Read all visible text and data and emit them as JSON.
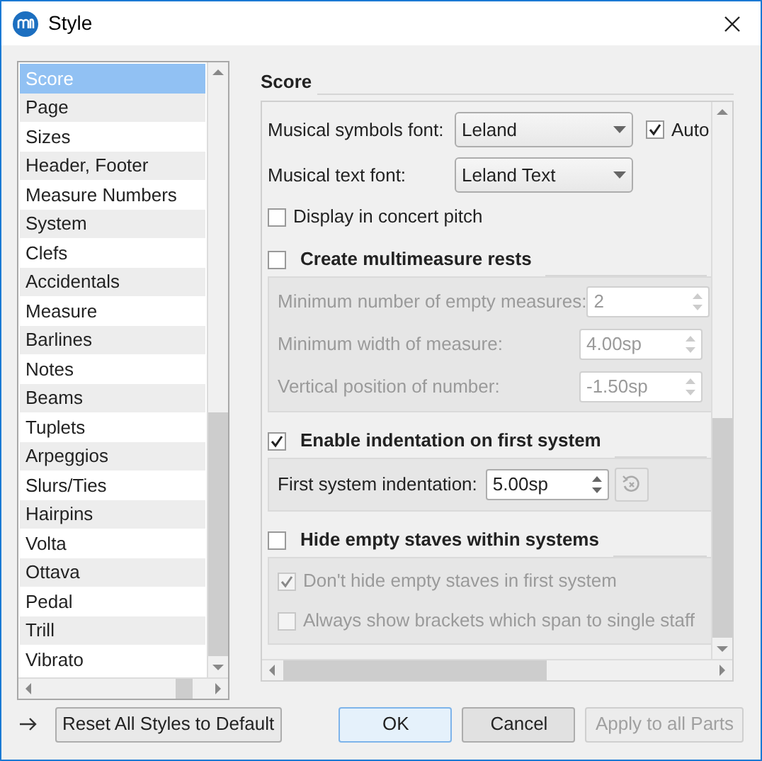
{
  "window": {
    "title": "Style"
  },
  "sidebar": {
    "items": [
      {
        "label": "Score",
        "selected": true
      },
      {
        "label": "Page",
        "selected": false
      },
      {
        "label": "Sizes",
        "selected": false
      },
      {
        "label": "Header, Footer",
        "selected": false
      },
      {
        "label": "Measure Numbers",
        "selected": false
      },
      {
        "label": "System",
        "selected": false
      },
      {
        "label": "Clefs",
        "selected": false
      },
      {
        "label": "Accidentals",
        "selected": false
      },
      {
        "label": "Measure",
        "selected": false
      },
      {
        "label": "Barlines",
        "selected": false
      },
      {
        "label": "Notes",
        "selected": false
      },
      {
        "label": "Beams",
        "selected": false
      },
      {
        "label": "Tuplets",
        "selected": false
      },
      {
        "label": "Arpeggios",
        "selected": false
      },
      {
        "label": "Slurs/Ties",
        "selected": false
      },
      {
        "label": "Hairpins",
        "selected": false
      },
      {
        "label": "Volta",
        "selected": false
      },
      {
        "label": "Ottava",
        "selected": false
      },
      {
        "label": "Pedal",
        "selected": false
      },
      {
        "label": "Trill",
        "selected": false
      },
      {
        "label": "Vibrato",
        "selected": false
      }
    ]
  },
  "section": {
    "title": "Score",
    "font_rows": [
      {
        "label": "Musical symbols font:",
        "value": "Leland",
        "auto": {
          "label": "Auto",
          "checked": true
        }
      },
      {
        "label": "Musical text font:",
        "value": "Leland Text"
      }
    ],
    "concert_pitch": {
      "label": "Display in concert pitch",
      "checked": false
    },
    "groups": [
      {
        "title": "Create multimeasure rests",
        "checked": false,
        "rows": [
          {
            "kind": "spin",
            "label": "Minimum number of empty measures:",
            "value": "2"
          },
          {
            "kind": "spin",
            "label": "Minimum width of measure:",
            "value": "4.00sp"
          },
          {
            "kind": "spin",
            "label": "Vertical position of number:",
            "value": "-1.50sp"
          }
        ]
      },
      {
        "title": "Enable indentation on first system",
        "checked": true,
        "rows": [
          {
            "kind": "spin_reset",
            "label": "First system indentation:",
            "value": "5.00sp"
          }
        ]
      },
      {
        "title": "Hide empty staves within systems",
        "checked": false,
        "rows": [
          {
            "kind": "check",
            "label": "Don't hide empty staves in first system",
            "checked": true
          },
          {
            "kind": "check",
            "label": "Always show brackets which span to single staff",
            "checked": false
          }
        ]
      }
    ]
  },
  "footer": {
    "reset": "Reset All Styles to Default",
    "buttons": [
      {
        "label": "OK",
        "disabled": false,
        "default": true
      },
      {
        "label": "Cancel",
        "disabled": false,
        "default": false
      },
      {
        "label": "Apply to all Parts",
        "disabled": true,
        "default": false
      }
    ]
  }
}
